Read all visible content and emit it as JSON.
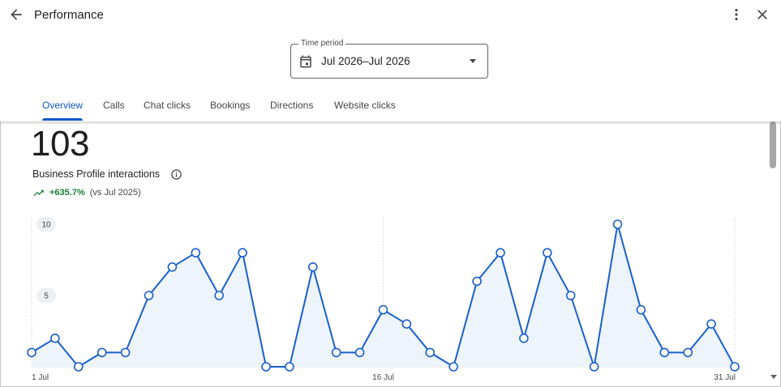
{
  "header": {
    "title": "Performance",
    "icons": {
      "back": "arrow-back-icon",
      "more": "more-vert-icon",
      "close": "close-icon"
    }
  },
  "time_period": {
    "label": "Time period",
    "value": "Jul 2026–Jul 2026",
    "icon": "calendar-icon"
  },
  "tabs": [
    {
      "label": "Overview",
      "active": true
    },
    {
      "label": "Calls",
      "active": false
    },
    {
      "label": "Chat clicks",
      "active": false
    },
    {
      "label": "Bookings",
      "active": false
    },
    {
      "label": "Directions",
      "active": false
    },
    {
      "label": "Website clicks",
      "active": false
    }
  ],
  "summary": {
    "total": "103",
    "label": "Business Profile interactions",
    "change": "+635.7%",
    "comparison": "(vs Jul 2025)",
    "trend_icon": "trending-up-icon",
    "info_icon": "info-icon"
  },
  "colors": {
    "accent": "#0b57d0",
    "line": "#1a5fcc",
    "area": "#eef4fc",
    "positive": "#188038"
  },
  "chart_data": {
    "type": "area",
    "x": [
      "1 Jul",
      "2 Jul",
      "3 Jul",
      "4 Jul",
      "5 Jul",
      "6 Jul",
      "7 Jul",
      "8 Jul",
      "9 Jul",
      "10 Jul",
      "11 Jul",
      "12 Jul",
      "13 Jul",
      "14 Jul",
      "15 Jul",
      "16 Jul",
      "17 Jul",
      "18 Jul",
      "19 Jul",
      "20 Jul",
      "21 Jul",
      "22 Jul",
      "23 Jul",
      "24 Jul",
      "25 Jul",
      "26 Jul",
      "27 Jul",
      "28 Jul",
      "29 Jul",
      "30 Jul",
      "31 Jul"
    ],
    "series": [
      {
        "values": [
          1,
          2,
          0,
          1,
          1,
          5,
          7,
          8,
          5,
          8,
          0,
          0,
          7,
          1,
          1,
          4,
          3,
          1,
          0,
          6,
          8,
          2,
          8,
          5,
          0,
          10,
          4,
          1,
          1,
          3,
          0
        ]
      }
    ],
    "ylim": [
      0,
      10
    ],
    "yticks": [
      "5",
      "10"
    ],
    "xticks": [
      "1 Jul",
      "16 Jul",
      "31 Jul"
    ],
    "grid": "vertical dashed"
  }
}
